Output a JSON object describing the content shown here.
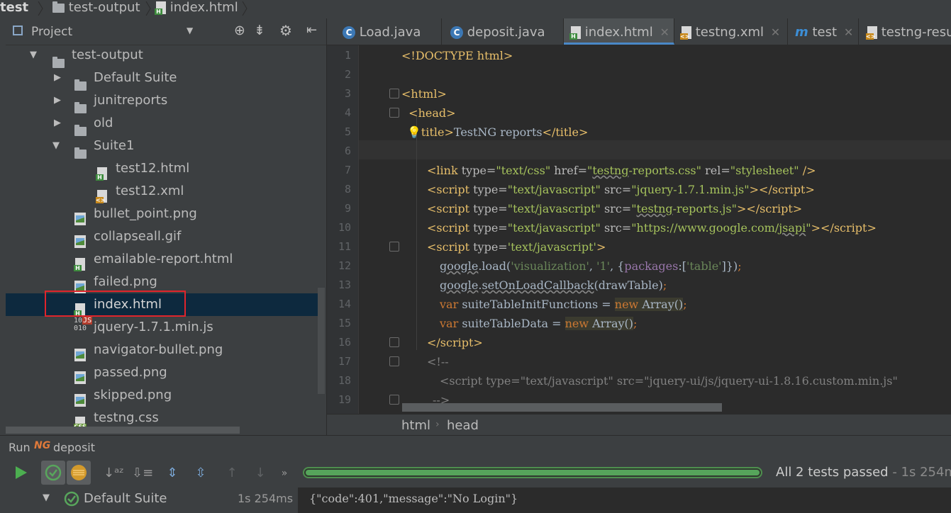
{
  "breadcrumb": {
    "project": "test",
    "folder": "test-output",
    "file": "index.html"
  },
  "project_panel": {
    "title": "Project",
    "tree": [
      {
        "label": "test-output",
        "icon": "folder-icon",
        "expanded": true
      },
      {
        "label": "Default Suite",
        "icon": "folder-icon",
        "expanded": false
      },
      {
        "label": "junitreports",
        "icon": "folder-icon",
        "expanded": false
      },
      {
        "label": "old",
        "icon": "folder-icon",
        "expanded": false
      },
      {
        "label": "Suite1",
        "icon": "folder-icon",
        "expanded": true
      },
      {
        "label": "test12.html",
        "icon": "html-file-icon"
      },
      {
        "label": "test12.xml",
        "icon": "xml-file-icon"
      },
      {
        "label": "bullet_point.png",
        "icon": "image-file-icon"
      },
      {
        "label": "collapseall.gif",
        "icon": "image-file-icon"
      },
      {
        "label": "emailable-report.html",
        "icon": "html-file-icon"
      },
      {
        "label": "failed.png",
        "icon": "image-file-icon"
      },
      {
        "label": "index.html",
        "icon": "html-file-icon",
        "selected": true
      },
      {
        "label": "jquery-1.7.1.min.js",
        "icon": "js-file-icon"
      },
      {
        "label": "navigator-bullet.png",
        "icon": "image-file-icon"
      },
      {
        "label": "passed.png",
        "icon": "image-file-icon"
      },
      {
        "label": "skipped.png",
        "icon": "image-file-icon"
      },
      {
        "label": "testng.css",
        "icon": "css-file-icon"
      }
    ]
  },
  "tabs": [
    {
      "label": "Load.java",
      "icon": "java-class-icon"
    },
    {
      "label": "deposit.java",
      "icon": "java-class-icon"
    },
    {
      "label": "index.html",
      "icon": "html-file-icon",
      "active": true
    },
    {
      "label": "testng.xml",
      "icon": "xml-file-icon"
    },
    {
      "label": "test",
      "icon": "maven-icon"
    },
    {
      "label": "testng-resu",
      "icon": "xml-file-icon"
    }
  ],
  "editor": {
    "line_numbers": [
      "1",
      "2",
      "3",
      "4",
      "5",
      "6",
      "7",
      "8",
      "9",
      "10",
      "11",
      "12",
      "13",
      "14",
      "15",
      "16",
      "17",
      "18",
      "19"
    ],
    "breadcrumb": [
      "html",
      "head"
    ]
  },
  "run": {
    "title": "Run",
    "config": "deposit",
    "status": "All 2 tests passed",
    "status_time": "- 1s 254ms",
    "progress": 1.0,
    "tree_root": "Default Suite",
    "tree_time": "1s 254ms",
    "console": "{\"code\":401,\"message\":\"No Login\"}"
  },
  "colors": {
    "selection": "#0d293e",
    "accent": "#4a88c7",
    "pass": "#56a55b",
    "highlight_box": "#e0242b"
  }
}
